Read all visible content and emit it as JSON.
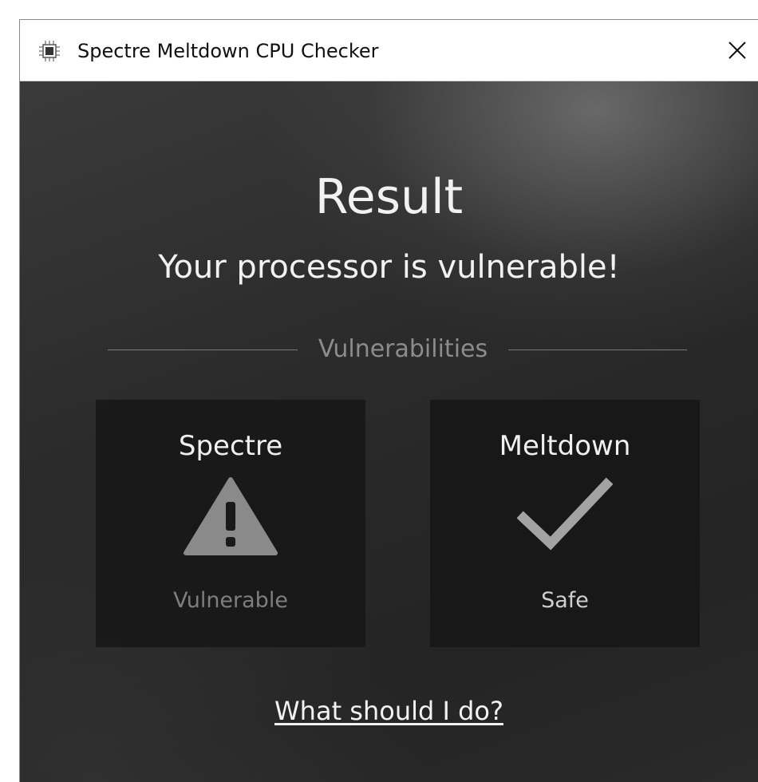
{
  "window": {
    "title": "Spectre Meltdown CPU Checker",
    "app_icon": "cpu-chip-icon",
    "close_icon": "close-icon",
    "close_glyph": "✕"
  },
  "main": {
    "heading": "Result",
    "status_message": "Your processor is vulnerable!",
    "section_label": "Vulnerabilities",
    "cards": [
      {
        "title": "Spectre",
        "icon": "warning-triangle-icon",
        "status": "Vulnerable"
      },
      {
        "title": "Meltdown",
        "icon": "checkmark-icon",
        "status": "Safe"
      }
    ],
    "help_link": "What should I do?"
  },
  "colors": {
    "background": "#2a2a2a",
    "card_background": "#141414",
    "text_primary": "#f2f2f2",
    "vulnerable_gray": "#7e7e7e",
    "safe_gray": "#cfcfcf",
    "icon_gray": "#8a8a8a"
  }
}
